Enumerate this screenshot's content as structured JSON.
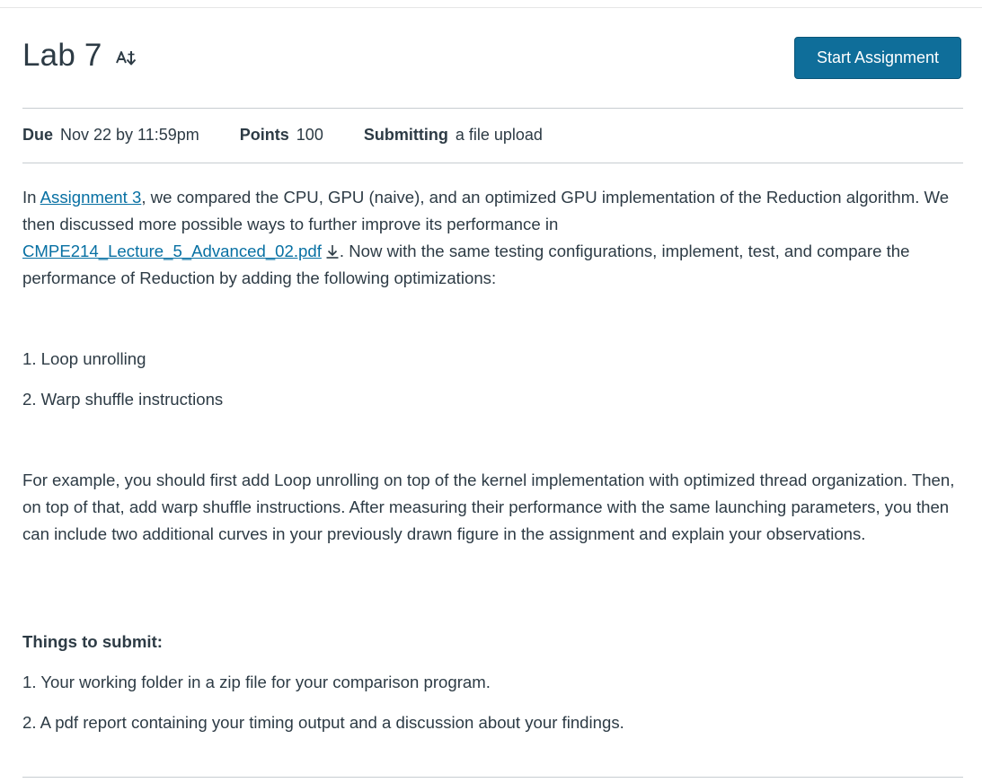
{
  "header": {
    "title": "Lab 7",
    "start_button": "Start Assignment"
  },
  "details": {
    "due_label": "Due",
    "due_value": "Nov 22 by 11:59pm",
    "points_label": "Points",
    "points_value": "100",
    "submitting_label": "Submitting",
    "submitting_value": "a file upload"
  },
  "content": {
    "p1_prefix": "In ",
    "p1_link": "Assignment 3",
    "p1_mid": ", we compared the CPU, GPU (naive), and an optimized GPU implementation of the Reduction algorithm. We then discussed more possible ways to further improve its performance in ",
    "p1_file_link": "CMPE214_Lecture_5_Advanced_02.pdf",
    "p1_suffix": ". Now with the same testing configurations, implement, test, and compare the performance of Reduction by adding the following optimizations:",
    "list_items": [
      "1. Loop unrolling",
      "2. Warp shuffle instructions"
    ],
    "p2": "For example, you should first add Loop unrolling on top of the kernel implementation with optimized thread organization. Then, on top of that, add warp shuffle instructions. After measuring their performance with the same launching parameters, you then can include two additional curves in your previously drawn figure in the assignment and explain your observations.",
    "things_heading": "Things to submit:",
    "submit_items": [
      "1. Your working folder in a zip file for your comparison program.",
      "2. A pdf report containing your timing output and a discussion about your findings."
    ]
  },
  "icons": {
    "ai": "ai-icon",
    "download": "download-icon"
  },
  "colors": {
    "button": "#0f6e9a",
    "link": "#0770a3",
    "text": "#2d3b45"
  }
}
